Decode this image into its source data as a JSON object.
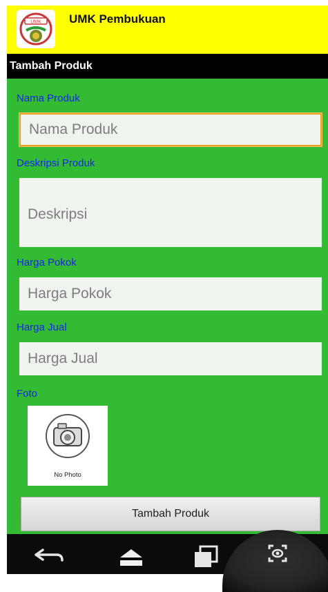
{
  "app": {
    "title": "UMK Pembukuan",
    "logo_label": "UMK"
  },
  "section": {
    "title": "Tambah Produk"
  },
  "form": {
    "name": {
      "label": "Nama Produk",
      "placeholder": "Nama Produk",
      "value": ""
    },
    "description": {
      "label": "Deskripsi Produk",
      "placeholder": "Deskripsi",
      "value": ""
    },
    "cost_price": {
      "label": "Harga Pokok",
      "placeholder": "Harga Pokok",
      "value": ""
    },
    "sell_price": {
      "label": "Harga Jual",
      "placeholder": "Harga Jual",
      "value": ""
    },
    "photo": {
      "label": "Foto",
      "placeholder_text": "No Photo"
    },
    "submit_label": "Tambah Produk"
  },
  "navbar": {
    "icons": [
      "back-icon",
      "home-icon",
      "recent-apps-icon",
      "screenshot-icon"
    ]
  },
  "colors": {
    "header_bg": "#ffff00",
    "form_bg": "#33bb33",
    "label_color": "#1a24e8",
    "focus_border": "#f0a020"
  }
}
